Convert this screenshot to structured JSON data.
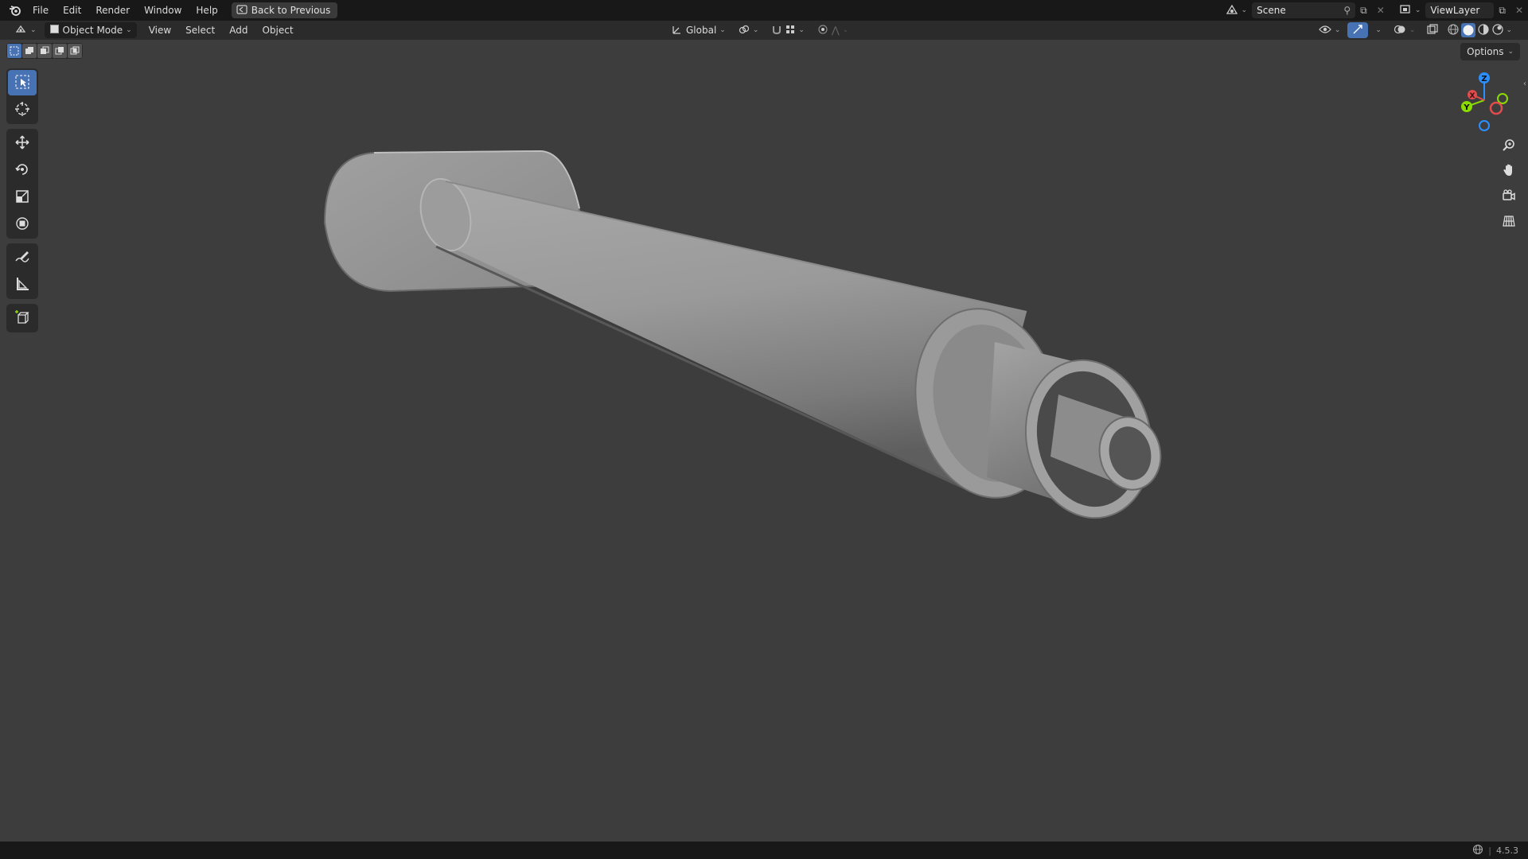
{
  "menubar": {
    "items": [
      "File",
      "Edit",
      "Render",
      "Window",
      "Help"
    ],
    "back_label": "Back to Previous",
    "scene_label": "Scene",
    "viewlayer_label": "ViewLayer"
  },
  "viewport_header": {
    "mode_label": "Object Mode",
    "menus": [
      "View",
      "Select",
      "Add",
      "Object"
    ],
    "orientation_label": "Global"
  },
  "options_label": "Options",
  "gizmo": {
    "x_label": "X",
    "y_label": "Y",
    "z_label": "Z"
  },
  "statusbar": {
    "version": "4.5.3"
  },
  "colors": {
    "accent": "#4772b3",
    "x_axis": "#e24c4c",
    "y_axis": "#8bdc00",
    "z_axis": "#2c8fff",
    "background": "#3d3d3d"
  },
  "icons": [
    "blender-logo-icon",
    "back-icon",
    "scene-icon",
    "pin-icon",
    "viewlayer-icon",
    "editor-type-icon",
    "object-mode-icon",
    "transform-orientation-icon",
    "pivot-icon",
    "snap-icon",
    "proportional-edit-icon",
    "visibility-icon",
    "gizmo-icon",
    "overlay-icon",
    "xray-icon",
    "wireframe-shading-icon",
    "solid-shading-icon",
    "material-shading-icon",
    "rendered-shading-icon",
    "select-box-icon",
    "cursor-icon",
    "move-icon",
    "rotate-icon",
    "scale-icon",
    "transform-icon",
    "annotate-icon",
    "measure-icon",
    "add-cube-icon",
    "zoom-icon",
    "hand-icon",
    "camera-icon",
    "grid-icon",
    "network-icon"
  ]
}
